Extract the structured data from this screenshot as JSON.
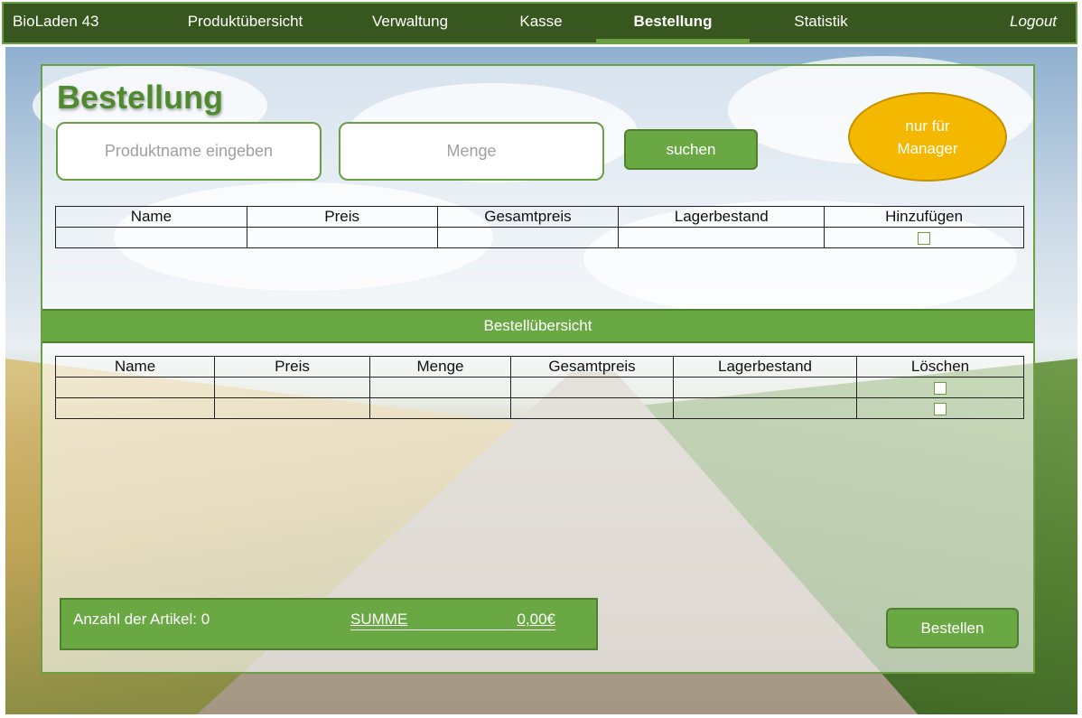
{
  "nav": {
    "brand": "BioLaden 43",
    "items": [
      {
        "label": "Produktübersicht"
      },
      {
        "label": "Verwaltung"
      },
      {
        "label": "Kasse"
      },
      {
        "label": "Bestellung"
      },
      {
        "label": "Statistik"
      }
    ],
    "active": "Bestellung",
    "logout": "Logout"
  },
  "page": {
    "title": "Bestellung",
    "search": {
      "product_placeholder": "Produktname eingeben",
      "quantity_placeholder": "Menge",
      "button": "suchen"
    },
    "manager_badge": {
      "line1": "nur für",
      "line2": "Manager"
    }
  },
  "search_table": {
    "headers": [
      "Name",
      "Preis",
      "Gesamtpreis",
      "Lagerbestand",
      "Hinzufügen"
    ]
  },
  "order_section": {
    "title": "Bestellübersicht",
    "headers": [
      "Name",
      "Preis",
      "Menge",
      "Gesamtpreis",
      "Lagerbestand",
      "Löschen"
    ]
  },
  "summary": {
    "count_label": "Anzahl der Artikel: 0",
    "sum_label": "SUMME",
    "sum_value": "0,00€"
  },
  "order_button": "Bestellen",
  "colors": {
    "nav_bg": "#37571f",
    "accent": "#6aa844",
    "title": "#4f8a2f",
    "manager": "#f5b800"
  }
}
